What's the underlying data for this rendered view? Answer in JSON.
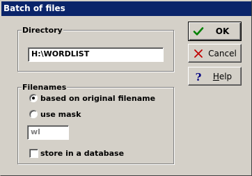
{
  "window": {
    "title": "Batch of files"
  },
  "directory": {
    "label": "Directory",
    "value": "H:\\WORDLIST"
  },
  "filenames": {
    "label": "Filenames",
    "option_original": "based on original filename",
    "option_original_selected": true,
    "option_mask": "use mask",
    "option_mask_selected": false,
    "mask_value": "wl",
    "store_db_label": "store in a database",
    "store_db_checked": false
  },
  "buttons": {
    "ok_label": "OK",
    "cancel_label": "Cancel",
    "help_label": "Help"
  },
  "icons": {
    "ok": "checkmark-icon",
    "cancel": "cross-icon",
    "help": "question-mark-icon"
  },
  "colors": {
    "titlebar": "#0a246a",
    "face": "#d4d0c8",
    "ok_icon": "#008000",
    "cancel_icon": "#c00000",
    "help_icon": "#000080"
  }
}
